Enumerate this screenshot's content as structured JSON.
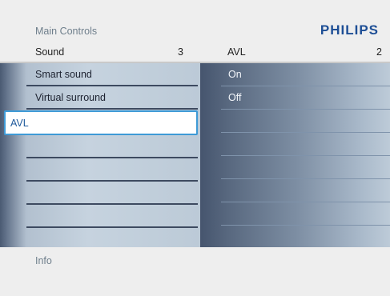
{
  "menu": {
    "breadcrumb": "Main Controls",
    "brand": "PHILIPS"
  },
  "left_header": {
    "label": "Sound",
    "count": "3"
  },
  "left_items": [
    {
      "label": "Smart sound"
    },
    {
      "label": "Virtual surround"
    },
    {
      "label": "AVL"
    },
    {
      "label": ""
    },
    {
      "label": ""
    },
    {
      "label": ""
    },
    {
      "label": ""
    },
    {
      "label": ""
    }
  ],
  "right_header": {
    "label": "AVL",
    "count": "2"
  },
  "right_items": [
    {
      "label": "On"
    },
    {
      "label": "Off"
    },
    {
      "label": ""
    },
    {
      "label": ""
    },
    {
      "label": ""
    },
    {
      "label": ""
    },
    {
      "label": ""
    },
    {
      "label": ""
    }
  ],
  "info": {
    "label": "Info"
  },
  "colors": {
    "brand": "#1d4e95",
    "selection_border": "#3e9ad6",
    "panel_dark": "#4a5a72"
  }
}
